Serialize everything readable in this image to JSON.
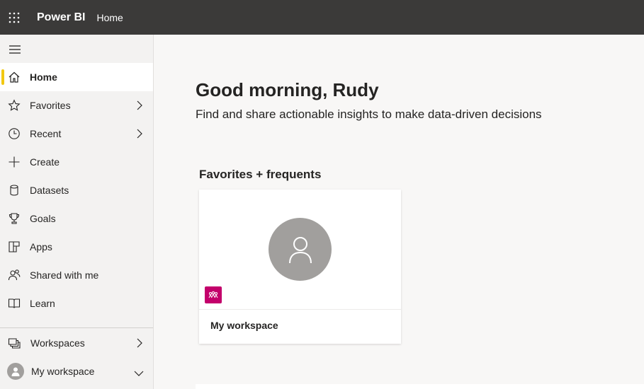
{
  "topbar": {
    "app_name": "Power BI",
    "breadcrumb": "Home"
  },
  "sidebar": {
    "items": [
      {
        "label": "Home",
        "icon": "home-icon",
        "active": true
      },
      {
        "label": "Favorites",
        "icon": "star-icon",
        "has_chevron": true
      },
      {
        "label": "Recent",
        "icon": "clock-icon",
        "has_chevron": true
      },
      {
        "label": "Create",
        "icon": "plus-icon"
      },
      {
        "label": "Datasets",
        "icon": "database-icon"
      },
      {
        "label": "Goals",
        "icon": "trophy-icon"
      },
      {
        "label": "Apps",
        "icon": "apps-icon"
      },
      {
        "label": "Shared with me",
        "icon": "people-icon"
      },
      {
        "label": "Learn",
        "icon": "book-icon"
      }
    ],
    "workspaces_label": "Workspaces",
    "my_workspace_label": "My workspace"
  },
  "main": {
    "greeting": "Good morning, Rudy",
    "subtitle": "Find and share actionable insights to make data-driven decisions",
    "section_title": "Favorites + frequents",
    "card": {
      "label": "My workspace",
      "badge_color": "#c3006b"
    }
  },
  "colors": {
    "topbar": "#3b3a39",
    "accent": "#f2c811"
  }
}
